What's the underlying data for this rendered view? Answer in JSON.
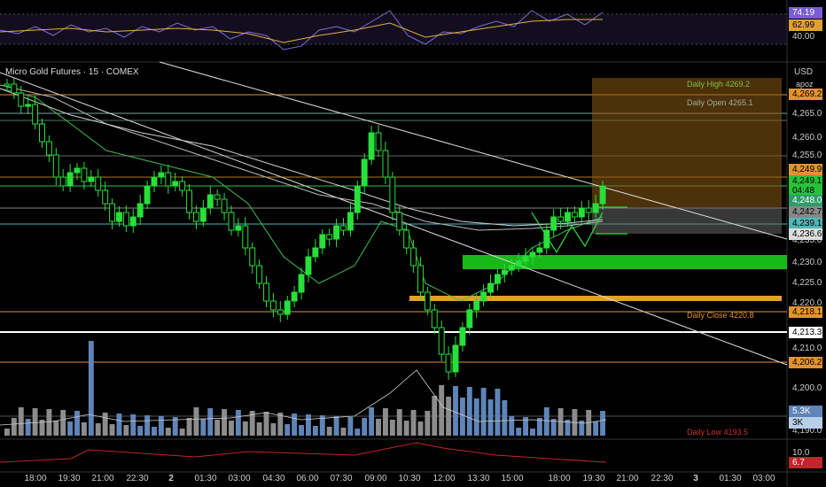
{
  "chart": {
    "title": "Micro Gold Futures · 15 · COMEX",
    "currency": "USD",
    "settings_label": "apoz",
    "price_ticks": [
      "4,265.0",
      "4,260.0",
      "4,255.0",
      "4,250.0",
      "4,245.0",
      "4,240.0",
      "4,235.0",
      "4,230.0",
      "4,225.0",
      "4,220.0",
      "4,215.0",
      "4,210.0",
      "4,205.0",
      "4,200.0",
      "4,195.0",
      "4,190.0"
    ],
    "rsi_ticks": [
      "60.00",
      "40.00"
    ],
    "osc_ticks": [
      "10.0"
    ],
    "time_labels": [
      "18:00",
      "19:30",
      "21:00",
      "22:30",
      "2",
      "01:30",
      "03:00",
      "04:30",
      "06:00",
      "07:30",
      "09:00",
      "10:30",
      "12:00",
      "13:30",
      "15:00",
      "18:00",
      "19:30",
      "21:00",
      "22:30",
      "3",
      "01:30",
      "03:00"
    ],
    "badges": {
      "rsi_high": "74.19",
      "rsi_low": "62.99",
      "daily_high_axis": "4,269.2",
      "level_1": "4,249.9",
      "last_price": "4,249.1",
      "countdown": "04:48",
      "level_2": "4,248.0",
      "level_3": "4,242.7",
      "level_4": "4,239.1",
      "level_5": "4,236.6",
      "daily_close_axis": "4,218.1",
      "level_6": "4,213.3",
      "level_7": "4,206.2",
      "volume_1": "5.3K",
      "volume_2": "3K",
      "osc_value": "6.7"
    },
    "level_labels": {
      "daily_high": "Daily High 4269.2",
      "daily_open": "Daily Open 4265.1",
      "daily_close": "Daily Close 4220.8",
      "daily_low": "Daily Low 4193.5"
    },
    "colors": {
      "up": "#27e03a",
      "down": "#27e03a",
      "orange": "#e0932f",
      "zone_orange": "#8a5a12",
      "zone_green": "#19b719",
      "volume": "#5f84b8",
      "volume_grey": "#8c8c8c"
    }
  }
}
